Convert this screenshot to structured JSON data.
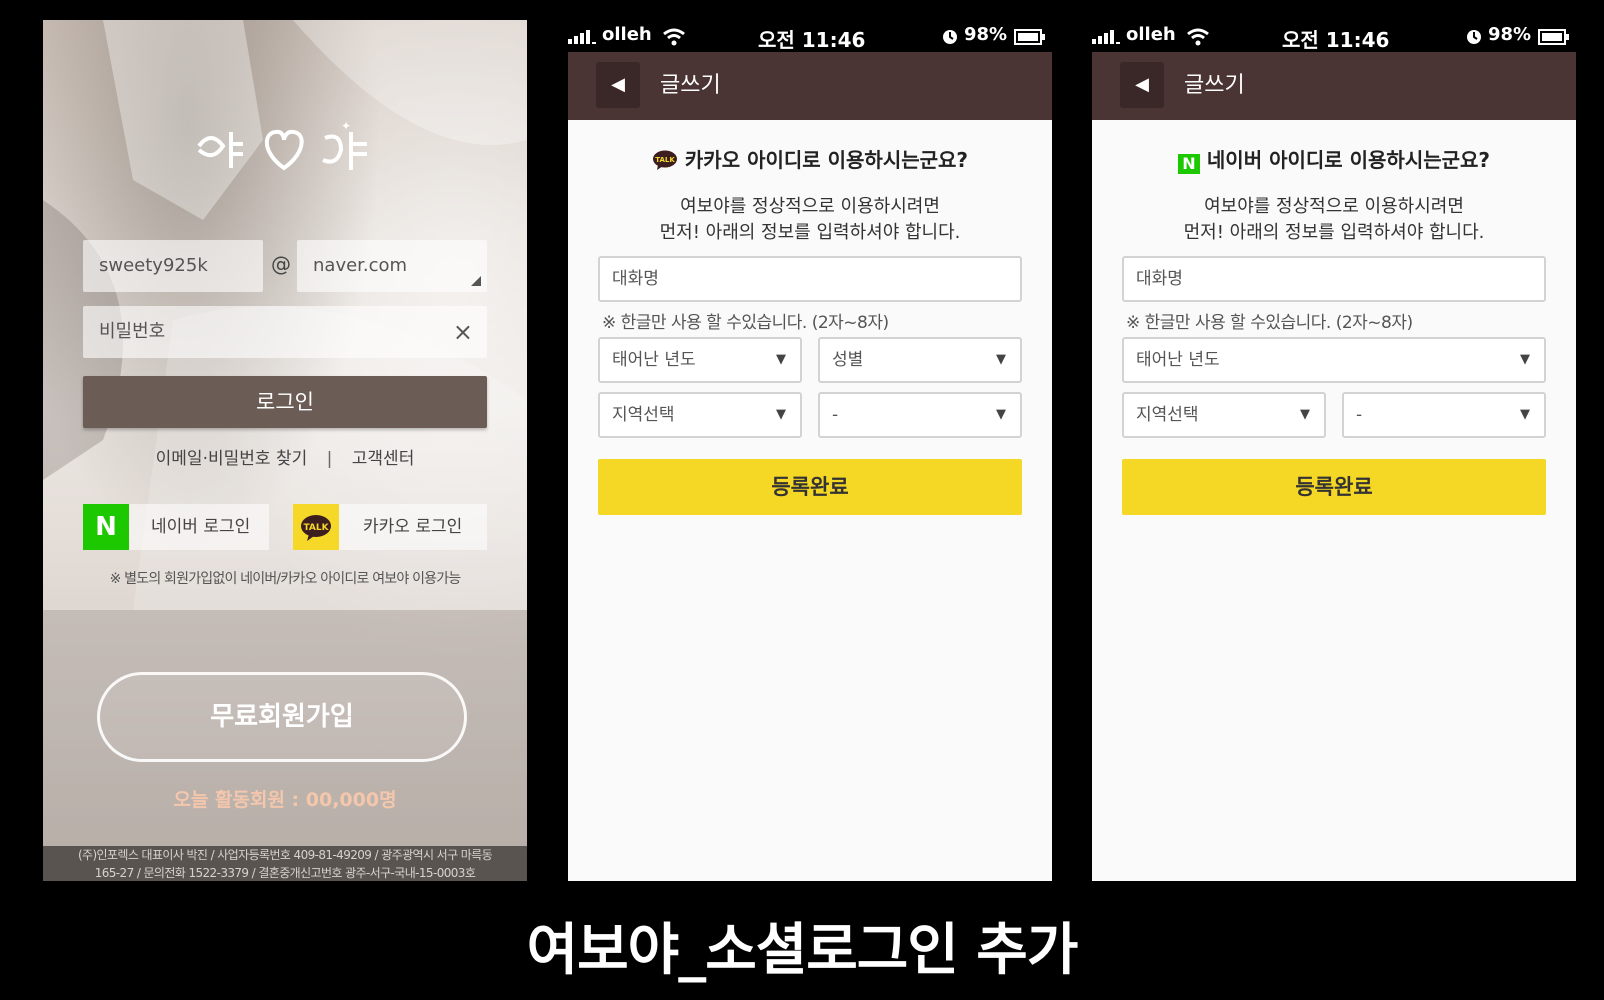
{
  "login": {
    "logo_text": "여보야",
    "email_id": "sweety925k",
    "at_sign": "@",
    "email_domain": "naver.com",
    "password_placeholder": "비밀번호",
    "clear_icon": "×",
    "login_button": "로그인",
    "find_link": "이메일·비밀번호 찾기",
    "separator": "|",
    "support_link": "고객센터",
    "naver_icon_letter": "N",
    "naver_login": "네이버 로그인",
    "kakao_icon_text": "TALK",
    "kakao_login": "카카오 로그인",
    "social_note": "※ 별도의 회원가입없이 네이버/카카오 아이디로 여보야 이용가능",
    "join_button": "무료회원가입",
    "active_members": "오늘 활동회원 : 00,000명",
    "footer_line1": "(주)인포렉스 대표이사 박진 / 사업자등록번호 409-81-49209 / 광주광역시 서구 마륵동",
    "footer_line2": "165-27 / 문의전화 1522-3379 / 결혼중개신고번호 광주-서구-국내-15-0003호"
  },
  "status_bar": {
    "carrier": "olleh",
    "time": "오전 11:46",
    "battery": "98%"
  },
  "kakao_screen": {
    "back_icon": "◀",
    "title": "글쓰기",
    "badge_text": "TALK",
    "question": "카카오 아이디로 이용하시는군요?",
    "desc_line1": "여보야를 정상적으로 이용하시려면",
    "desc_line2": "먼저! 아래의 정보를 입력하셔야 합니다.",
    "nickname_placeholder": "대화명",
    "hint": "※ 한글만 사용 할 수있습니다. (2자~8자)",
    "birth_year": "태어난 년도",
    "gender": "성별",
    "region": "지역선택",
    "subregion": "-",
    "submit": "등록완료"
  },
  "naver_screen": {
    "back_icon": "◀",
    "title": "글쓰기",
    "badge_text": "N",
    "question": "네이버 아이디로 이용하시는군요?",
    "desc_line1": "여보야를 정상적으로 이용하시려면",
    "desc_line2": "먼저! 아래의 정보를 입력하셔야 합니다.",
    "nickname_placeholder": "대화명",
    "hint": "※ 한글만 사용 할 수있습니다. (2자~8자)",
    "birth_year": "태어난 년도",
    "region": "지역선택",
    "subregion": "-",
    "submit": "등록완료"
  },
  "caret": "▼",
  "caption": "여보야_소셜로그인 추가",
  "colors": {
    "naver_green": "#1ec800",
    "kakao_yellow": "#f6d928",
    "submit_yellow": "#f5d726",
    "app_bar": "#4a3434",
    "login_button": "#6b5d55",
    "active_text": "#f4c7ad"
  }
}
